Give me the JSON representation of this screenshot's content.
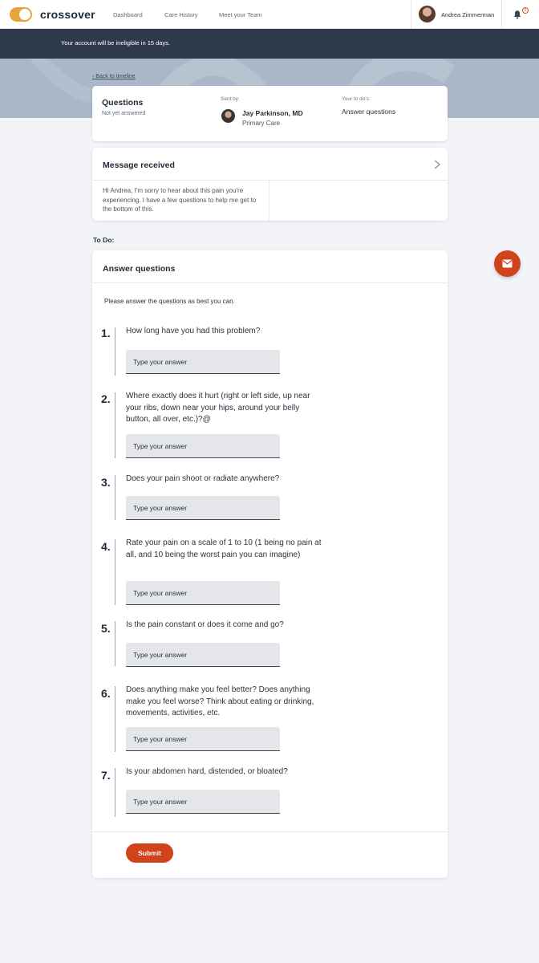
{
  "nav": {
    "brand": "crossover",
    "links": [
      "Dashboard",
      "Care History",
      "Meet your Team"
    ],
    "user_name": "Andrea Zimmerman",
    "notification_count": "5",
    "icons": [
      "toggle-logo-icon",
      "bell-icon"
    ]
  },
  "alert": {
    "text": "Your account will be ineligible in 15 days."
  },
  "back_link": "Back to timeline",
  "questions_card": {
    "title": "Questions",
    "status": "Not yet answered",
    "sent_by_label": "Sent by:",
    "sender_name": "Jay Parkinson, MD",
    "sender_role": "Primary Care",
    "todo_label": "Your to do's:",
    "todo_value": "Answer questions"
  },
  "message_card": {
    "title": "Message received",
    "body": "Hi Andrea, I'm sorry to hear about this pain you're experiencing. I have a few questions to help me get to the bottom of this."
  },
  "todo_heading": "To Do:",
  "answer_card": {
    "title": "Answer questions",
    "intro": "Please answer the questions as best you can.",
    "placeholder": "Type your answer",
    "questions": [
      {
        "num": "1.",
        "text": "How long have you had this problem?"
      },
      {
        "num": "2.",
        "text": "Where exactly does it hurt (right or left side, up near your ribs, down near your hips, around your belly button, all over, etc.)?@"
      },
      {
        "num": "3.",
        "text": "Does your pain shoot or radiate anywhere?"
      },
      {
        "num": "4.",
        "text": "Rate your pain on a scale of 1 to 10 (1 being no pain at all, and 10 being the worst pain you can imagine)"
      },
      {
        "num": "5.",
        "text": "Is the pain constant or does it come and go?"
      },
      {
        "num": "6.",
        "text": "Does anything make you feel better? Does anything make you feel worse? Think about eating or drinking, movements, activities, etc."
      },
      {
        "num": "7.",
        "text": "Is your abdomen hard, distended, or bloated?"
      }
    ],
    "submit_label": "Submit"
  },
  "colors": {
    "accent": "#d0431b",
    "brand_toggle": "#e8a33c",
    "alert_bar": "#2e3a4b"
  }
}
